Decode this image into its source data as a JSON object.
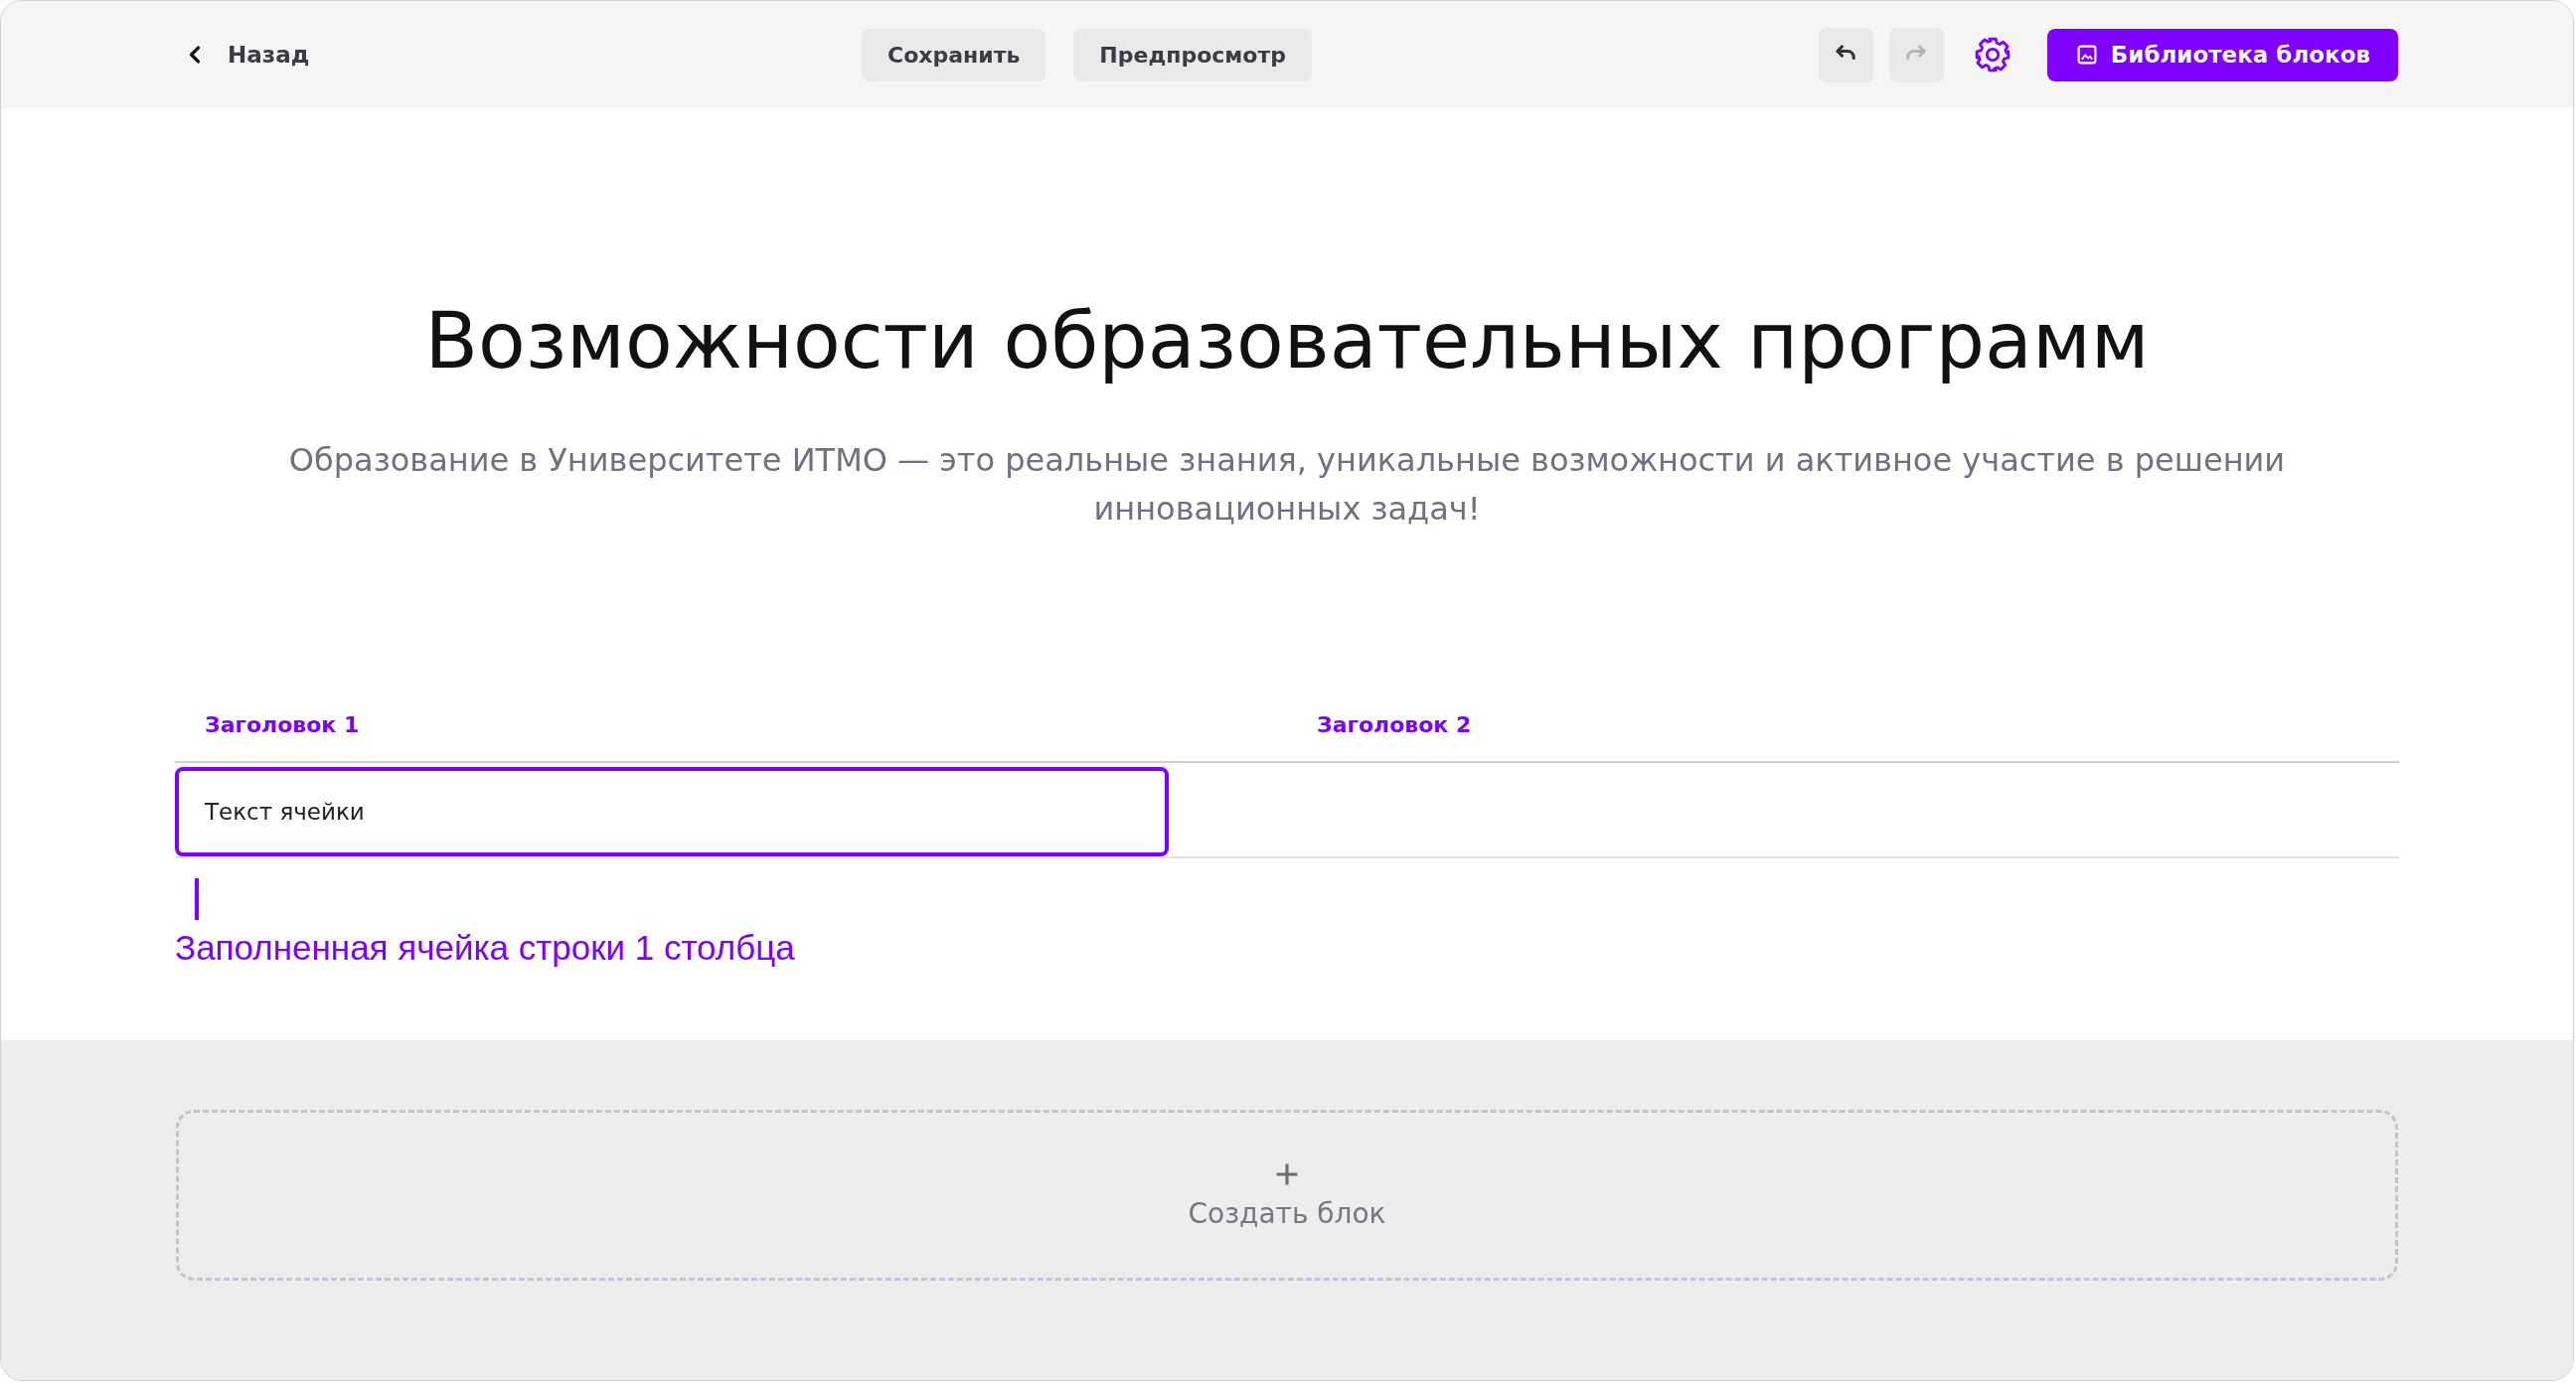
{
  "toolbar": {
    "back": "Назад",
    "buttons": [
      "Сохранить",
      "Предпросмотр"
    ],
    "undo": {
      "disabled": false
    },
    "redo": {
      "disabled": true
    },
    "library_button": "Библиотека блоков"
  },
  "hero": {
    "title": "Возможности образовательных программ",
    "subtitle": "Образование в Университете ИТМО — это реальные знания, уникальные возможности и активное участие в решении инновационных задач!"
  },
  "table": {
    "columns": [
      "Заголовок 1",
      "Заголовок 2"
    ],
    "rows": [
      [
        {
          "text": "Текст ячейки",
          "selected": true
        }
      ]
    ]
  },
  "annotation": "Заполненная ячейка строки 1 столбца",
  "create_block": "Создать блок"
}
